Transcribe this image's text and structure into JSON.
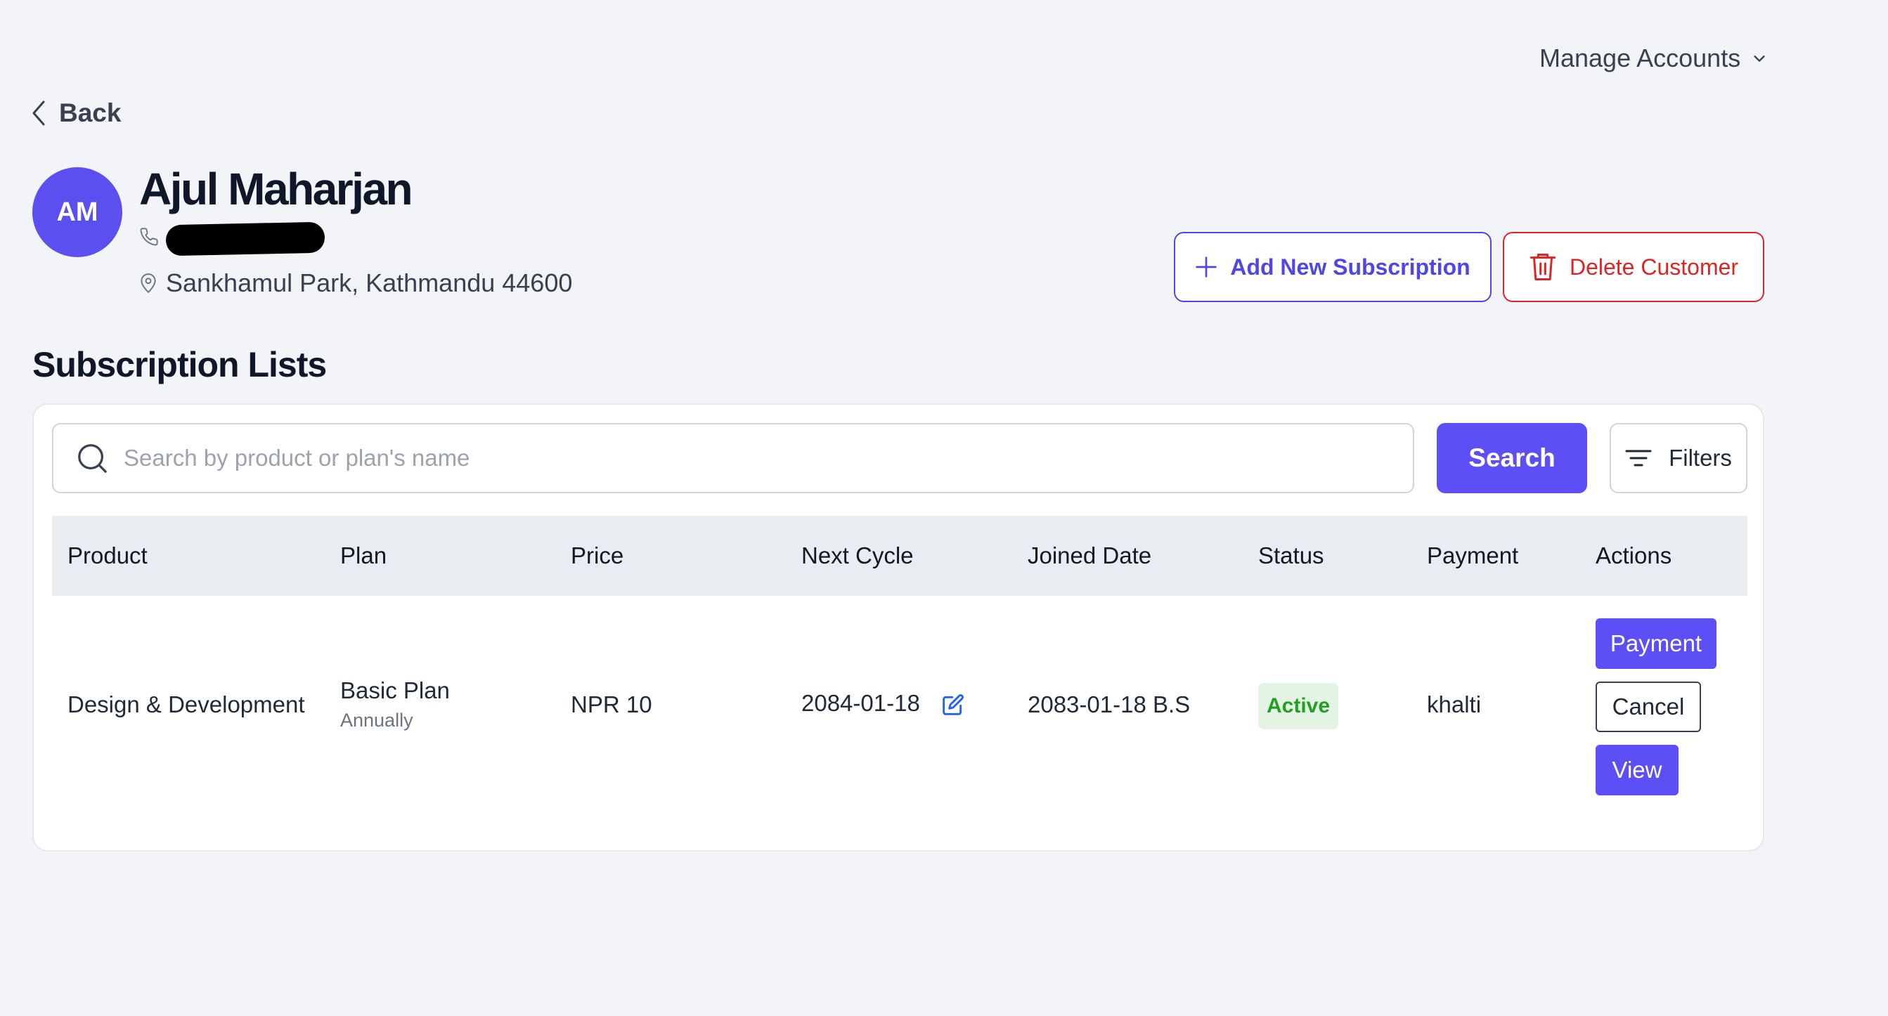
{
  "header": {
    "manage_accounts_label": "Manage Accounts",
    "back_label": "Back"
  },
  "customer": {
    "initials": "AM",
    "name": "Ajul Maharjan",
    "phone": "",
    "address": "Sankhamul Park, Kathmandu 44600"
  },
  "actions": {
    "add_subscription_label": "Add New Subscription",
    "delete_customer_label": "Delete Customer"
  },
  "subscriptions": {
    "title": "Subscription Lists",
    "search_placeholder": "Search by product or plan's name",
    "search_value": "",
    "search_button_label": "Search",
    "filters_button_label": "Filters",
    "columns": [
      "Product",
      "Plan",
      "Price",
      "Next Cycle",
      "Joined Date",
      "Status",
      "Payment",
      "Actions"
    ],
    "rows": [
      {
        "product": "Design & Development",
        "plan": "Basic Plan",
        "plan_period": "Annually",
        "price": "NPR 10",
        "next_cycle": "2084-01-18",
        "joined_date": "2083-01-18 B.S",
        "status": "Active",
        "payment": "khalti",
        "action_payment_label": "Payment",
        "action_cancel_label": "Cancel",
        "action_view_label": "View"
      }
    ]
  },
  "colors": {
    "primary": "#5b4ff5",
    "danger": "#dc2626",
    "status_active_bg": "#e4f4e4",
    "status_active_text": "#22a022"
  },
  "icons": {
    "back": "chevron-left-icon",
    "manage_accounts": "chevron-down-icon",
    "phone": "phone-icon",
    "address": "map-pin-icon",
    "add": "plus-icon",
    "delete": "trash-icon",
    "search": "search-icon",
    "filters": "filter-icon",
    "edit": "edit-icon"
  }
}
